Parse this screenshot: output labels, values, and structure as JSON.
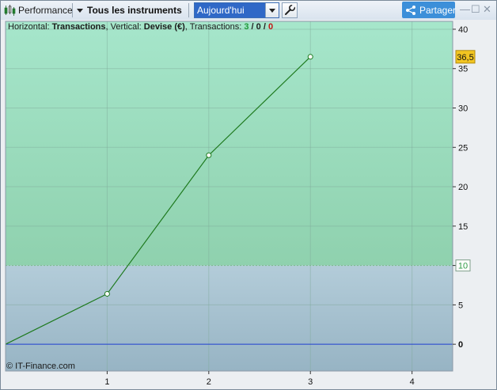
{
  "toolbar": {
    "title": "Performance",
    "instrument_filter": "Tous les instruments",
    "period_value": "Aujourd'hui",
    "share_label": "Partager",
    "minimize": "—",
    "maximize": "☐",
    "close": "✕"
  },
  "legend": {
    "h_label": "Horizontal: ",
    "h_value": "Transactions",
    "v_label": ", Vertical: ",
    "v_value": "Devise (€)",
    "t_label": ", Transactions: ",
    "wins": "3",
    "sep1": " / ",
    "neutral": "0",
    "sep2": " / ",
    "losses": "0"
  },
  "watermark": "© IT-Finance.com",
  "colors": {
    "gain_zone_top": "#a6e6cb",
    "gain_zone_bottom": "#8fd1ae",
    "loss_zone_top": "#b3ccd9",
    "loss_zone_bottom": "#97b4c4",
    "line": "#1e7a1e",
    "zero_line": "#1f3fd0",
    "current_badge": "#f2c521",
    "threshold_badge_text": "#2e9a44"
  },
  "chart_data": {
    "type": "line",
    "title": "",
    "xlabel": "",
    "ylabel": "",
    "x": [
      0,
      1,
      2,
      3
    ],
    "y": [
      0,
      6.4,
      24,
      36.5
    ],
    "xlim": [
      0,
      4.4
    ],
    "ylim": [
      -3.4,
      41
    ],
    "x_ticks": [
      1,
      2,
      3,
      4
    ],
    "y_ticks": [
      0,
      5,
      10,
      15,
      20,
      25,
      30,
      35,
      40
    ],
    "x_tick_labels": [
      "1",
      "2",
      "3",
      "4"
    ],
    "y_tick_labels": [
      "0",
      "5",
      "10",
      "15",
      "20",
      "25",
      "30",
      "35",
      "40"
    ],
    "current_value_label": "36,5",
    "threshold": 10,
    "threshold_label": "10",
    "grid": true
  }
}
